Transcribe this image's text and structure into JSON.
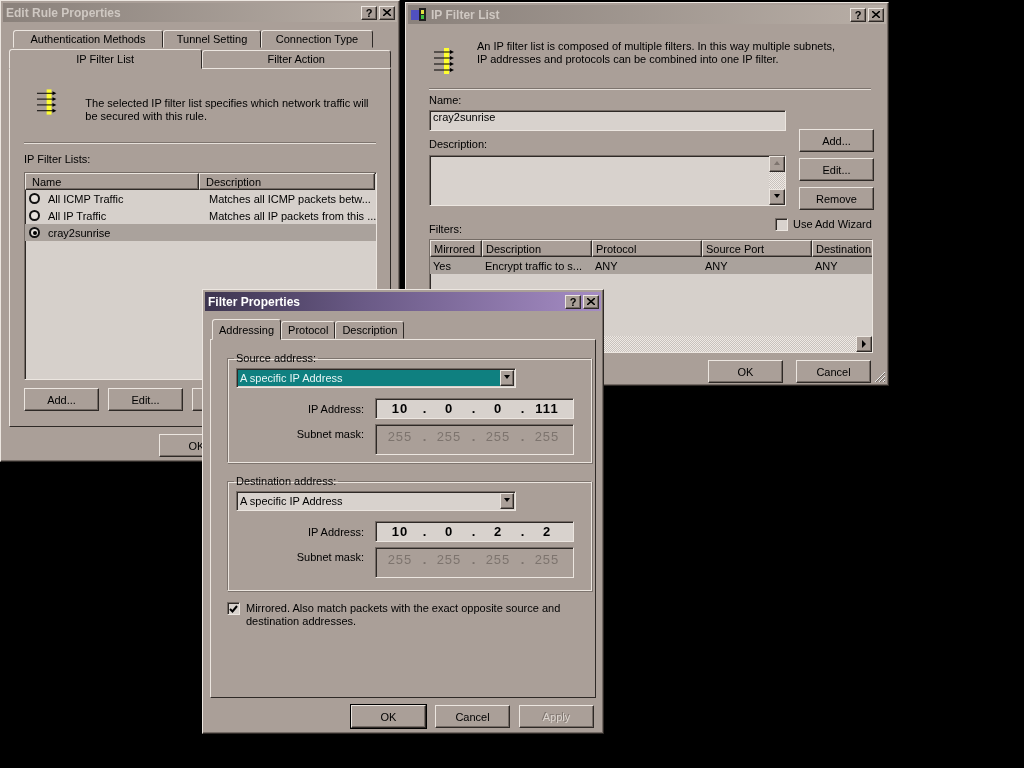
{
  "edit_rule_window": {
    "title": "Edit Rule Properties",
    "help": "?",
    "tab_rows": [
      [
        {
          "label": "Authentication Methods",
          "selected": false
        },
        {
          "label": "Tunnel Setting",
          "selected": false
        },
        {
          "label": "Connection Type",
          "selected": false
        }
      ],
      [
        {
          "label": "IP Filter List",
          "selected": true
        },
        {
          "label": "Filter Action",
          "selected": false
        }
      ]
    ],
    "intro": "The selected IP filter list specifies which network traffic will be secured with this rule.",
    "list_label": "IP Filter Lists:",
    "columns": [
      "Name",
      "Description"
    ],
    "rows": [
      {
        "name": "All ICMP Traffic",
        "description": "Matches all ICMP packets betw...",
        "selected": false
      },
      {
        "name": "All IP Traffic",
        "description": "Matches all IP packets from this ...",
        "selected": false
      },
      {
        "name": "cray2sunrise",
        "description": "",
        "selected": true
      }
    ],
    "buttons": [
      "Add...",
      "Edit..."
    ],
    "ok": "OK"
  },
  "ip_filter_list_window": {
    "title": "IP Filter List",
    "help": "?",
    "intro": "An IP filter list is composed of multiple filters. In this way multiple subnets, IP addresses and protocols can be combined into one IP filter.",
    "name_label": "Name:",
    "name_value": "cray2sunrise",
    "description_label": "Description:",
    "buttons": [
      "Add...",
      "Edit...",
      "Remove"
    ],
    "use_add_wizard": {
      "label": "Use Add Wizard",
      "checked": false
    },
    "filters_label": "Filters:",
    "columns": [
      "Mirrored",
      "Description",
      "Protocol",
      "Source Port",
      "Destination"
    ],
    "rows": [
      {
        "cells": [
          "Yes",
          "Encrypt traffic to s...",
          "ANY",
          "ANY",
          "ANY"
        ],
        "selected": true
      }
    ],
    "ok": "OK",
    "cancel": "Cancel"
  },
  "filter_properties_window": {
    "title": "Filter Properties",
    "help": "?",
    "tabs": [
      {
        "label": "Addressing",
        "selected": true
      },
      {
        "label": "Protocol",
        "selected": false
      },
      {
        "label": "Description",
        "selected": false
      }
    ],
    "separator": ".",
    "groups": [
      {
        "legend": "Source address:",
        "selection": "A specific IP Address",
        "highlighted": true,
        "ip_label": "IP Address:",
        "ip": [
          "10",
          "0",
          "0",
          "111"
        ],
        "mask_label": "Subnet mask:",
        "mask": [
          "255",
          "255",
          "255",
          "255"
        ],
        "mask_disabled": true
      },
      {
        "legend": "Destination address:",
        "selection": "A specific IP Address",
        "highlighted": false,
        "ip_label": "IP Address:",
        "ip": [
          "10",
          "0",
          "2",
          "2"
        ],
        "mask_label": "Subnet mask:",
        "mask": [
          "255",
          "255",
          "255",
          "255"
        ],
        "mask_disabled": true
      }
    ],
    "mirrored": {
      "text": "Mirrored. Also match packets with the exact opposite source and destination addresses.",
      "checked": true
    },
    "buttons": [
      {
        "label": "OK",
        "disabled": false
      },
      {
        "label": "Cancel",
        "disabled": false
      },
      {
        "label": "Apply",
        "disabled": true
      }
    ]
  }
}
